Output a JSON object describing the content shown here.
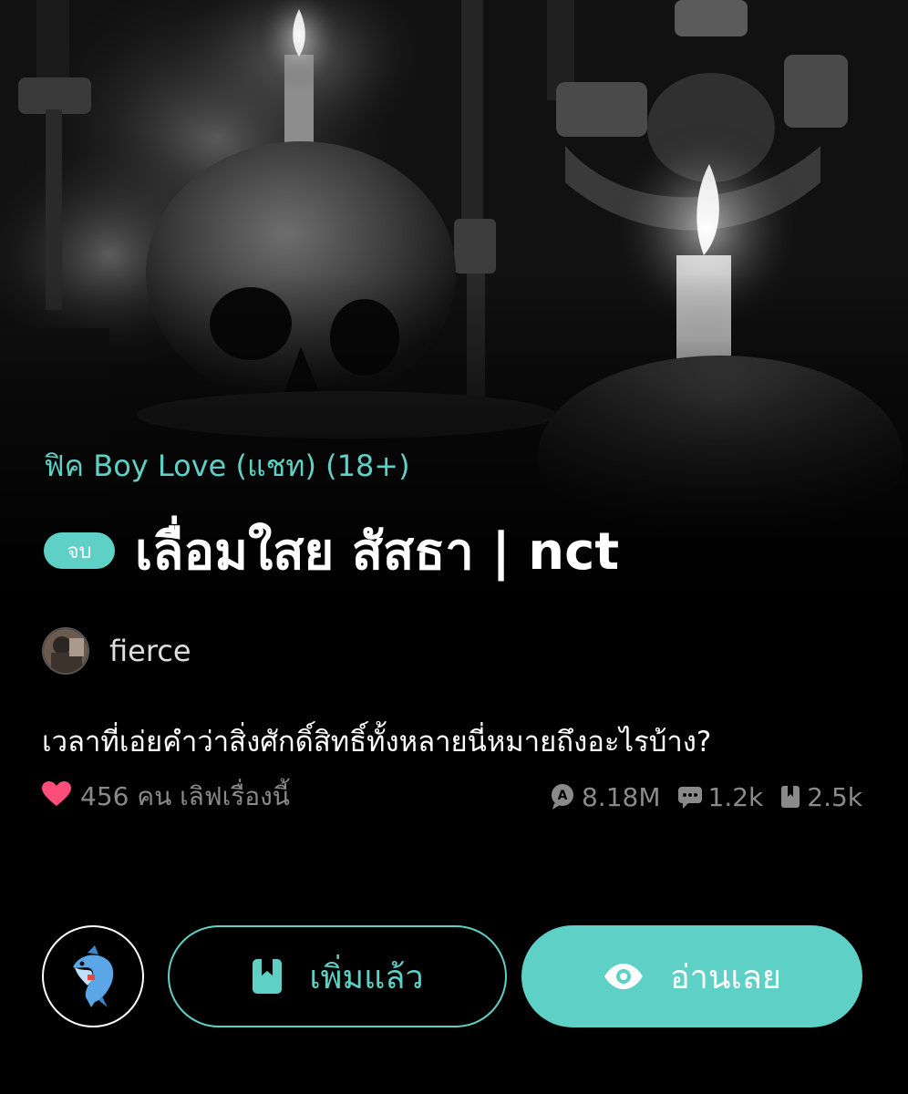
{
  "story": {
    "category": "ฟิค Boy Love (แชท) (18+)",
    "status_badge": "จบ",
    "title": "เลื่อมใสย สัสธา | nct",
    "author": "fierce",
    "synopsis": "เวลาที่เอ่ยคำว่าสิ่งศักดิ์สิทธิ์ทั้งหลายนี่หมายถึงอะไรบ้าง?"
  },
  "stats": {
    "likes_text": "456 คน เลิฟเรื่องนี้",
    "views": "8.18M",
    "comments": "1.2k",
    "bookmarks": "2.5k"
  },
  "actions": {
    "added_label": "เพิ่มแล้ว",
    "read_label": "อ่านเลย"
  },
  "icons": {
    "like": "heart-icon",
    "views": "views-icon",
    "comments": "comment-icon",
    "bookmarks": "book-icon",
    "added": "bookmark-icon",
    "read": "eye-icon",
    "mascot": "dolphin-icon"
  },
  "colors": {
    "accent": "#5fd0c6",
    "heart": "#ff4d7a",
    "muted": "#8a8a8a",
    "background": "#000000"
  }
}
